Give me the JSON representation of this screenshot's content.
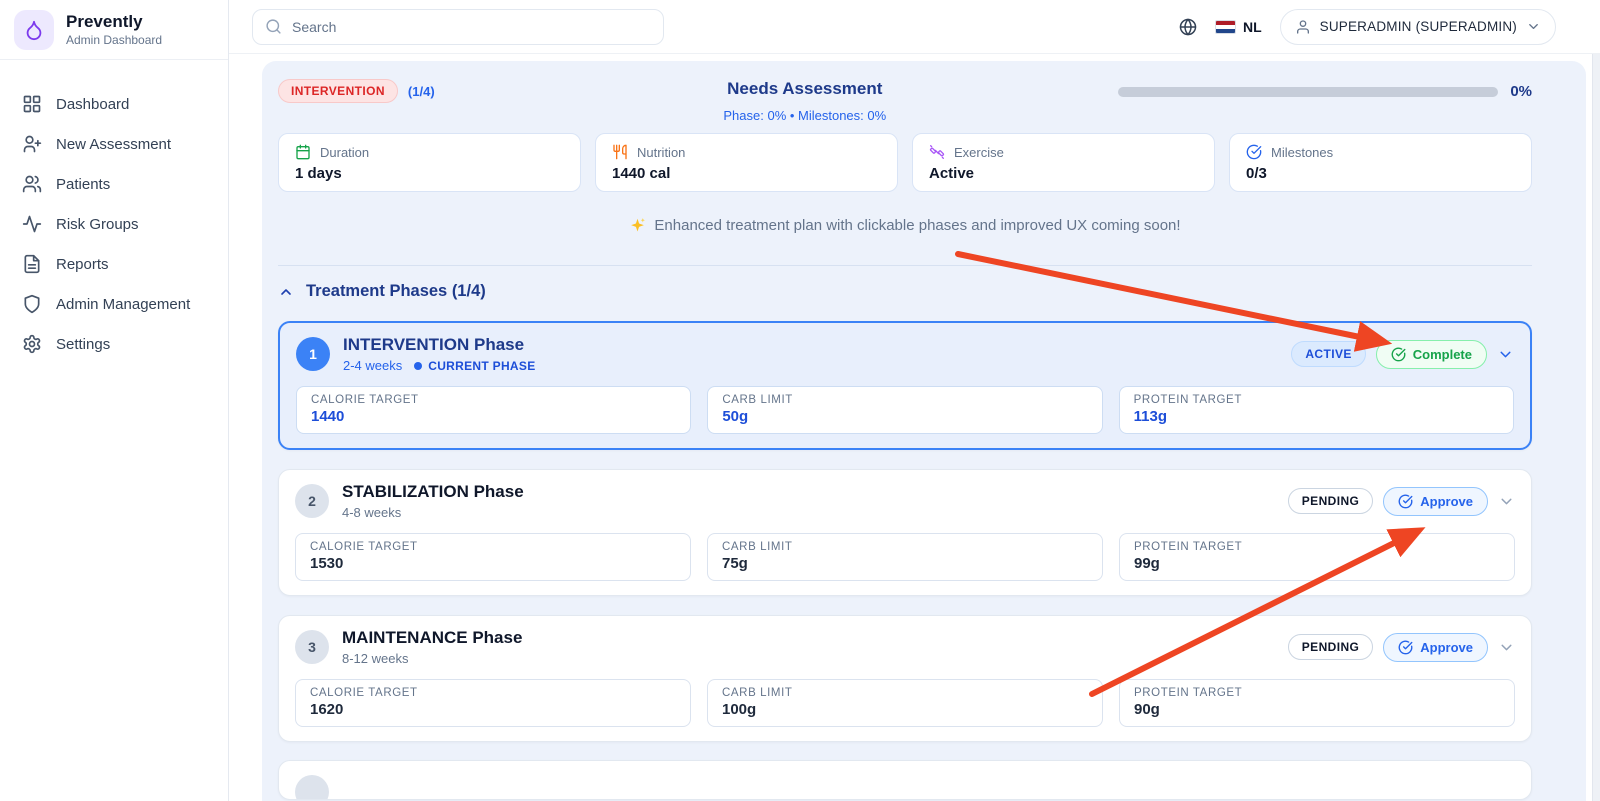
{
  "brand": {
    "name": "Prevently",
    "subtitle": "Admin Dashboard"
  },
  "sidebar": {
    "items": [
      {
        "label": "Dashboard"
      },
      {
        "label": "New Assessment"
      },
      {
        "label": "Patients"
      },
      {
        "label": "Risk Groups"
      },
      {
        "label": "Reports"
      },
      {
        "label": "Admin Management"
      },
      {
        "label": "Settings"
      }
    ]
  },
  "topbar": {
    "search_placeholder": "Search",
    "language": "NL",
    "user_label": "SUPERADMIN (SUPERADMIN)"
  },
  "assessment": {
    "phase_badge": "INTERVENTION",
    "phase_count": "(1/4)",
    "title": "Needs Assessment",
    "subtitle": "Phase: 0% • Milestones: 0%",
    "progress_label": "0%"
  },
  "stats": [
    {
      "label": "Duration",
      "value": "1 days",
      "icon": "calendar-icon",
      "color": "#16a34a"
    },
    {
      "label": "Nutrition",
      "value": "1440 cal",
      "icon": "utensils-icon",
      "color": "#f97316"
    },
    {
      "label": "Exercise",
      "value": "Active",
      "icon": "dumbbell-icon",
      "color": "#a855f7"
    },
    {
      "label": "Milestones",
      "value": "0/3",
      "icon": "circle-check-icon",
      "color": "#2563eb"
    }
  ],
  "banner": {
    "text": "Enhanced treatment plan with clickable phases and improved UX coming soon!"
  },
  "phases_section": {
    "title": "Treatment Phases (1/4)"
  },
  "phases": [
    {
      "number": "1",
      "title": "INTERVENTION Phase",
      "duration": "2-4 weeks",
      "current_label": "CURRENT PHASE",
      "status": "ACTIVE",
      "action": "Complete",
      "metrics": [
        {
          "label": "CALORIE TARGET",
          "value": "1440"
        },
        {
          "label": "CARB LIMIT",
          "value": "50g"
        },
        {
          "label": "PROTEIN TARGET",
          "value": "113g"
        }
      ]
    },
    {
      "number": "2",
      "title": "STABILIZATION Phase",
      "duration": "4-8 weeks",
      "status": "PENDING",
      "action": "Approve",
      "metrics": [
        {
          "label": "CALORIE TARGET",
          "value": "1530"
        },
        {
          "label": "CARB LIMIT",
          "value": "75g"
        },
        {
          "label": "PROTEIN TARGET",
          "value": "99g"
        }
      ]
    },
    {
      "number": "3",
      "title": "MAINTENANCE Phase",
      "duration": "8-12 weeks",
      "status": "PENDING",
      "action": "Approve",
      "metrics": [
        {
          "label": "CALORIE TARGET",
          "value": "1620"
        },
        {
          "label": "CARB LIMIT",
          "value": "100g"
        },
        {
          "label": "PROTEIN TARGET",
          "value": "90g"
        }
      ]
    }
  ],
  "colors": {
    "accent_blue": "#2563eb",
    "navy": "#1e3a8a",
    "active_border": "#3b82f6",
    "success_green": "#16a34a",
    "danger_red": "#dc2626",
    "arrow_red": "#ee4523"
  }
}
